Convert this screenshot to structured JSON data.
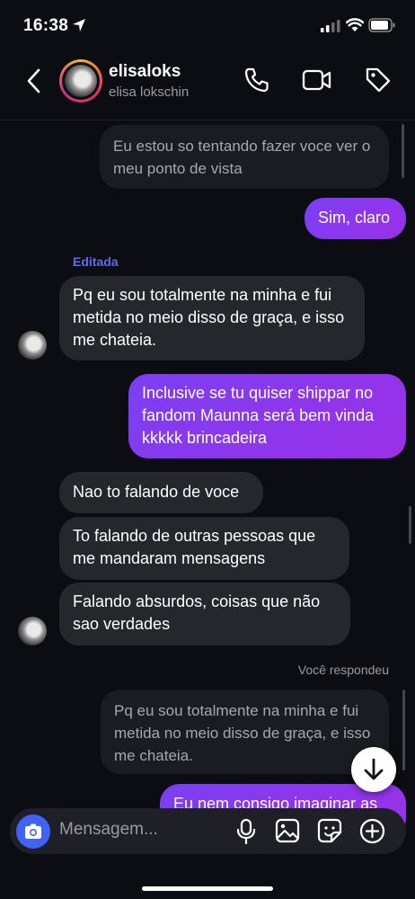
{
  "status_bar": {
    "time": "16:38"
  },
  "header": {
    "username": "elisaloks",
    "full_name": "elisa lokschin"
  },
  "messages": {
    "m1": "Eu estou so tentando fazer voce ver o meu ponto de vista",
    "m2": "Sim, claro",
    "edited_label": "Editada",
    "m3": "Pq eu sou totalmente na minha e fui metida no meio disso de graça, e isso me chateia.",
    "m4": "Inclusive se tu quiser shippar no fandom Maunna será bem vinda kkkkk brincadeira",
    "m5": "Nao to falando de voce",
    "m6": "To falando de outras pessoas que me mandaram mensagens",
    "m7": "Falando absurdos, coisas que não sao verdades",
    "replied_label": "Você respondeu",
    "quoted": "Pq eu sou totalmente na minha e fui metida no meio disso de graça, e isso me chateia.",
    "m8": "Eu nem consigo imaginar as"
  },
  "composer": {
    "placeholder": "Mensagem..."
  },
  "colors": {
    "accent": "#3f63f4",
    "outgoing": "#8a36ee",
    "edited": "#5b6cf0"
  }
}
